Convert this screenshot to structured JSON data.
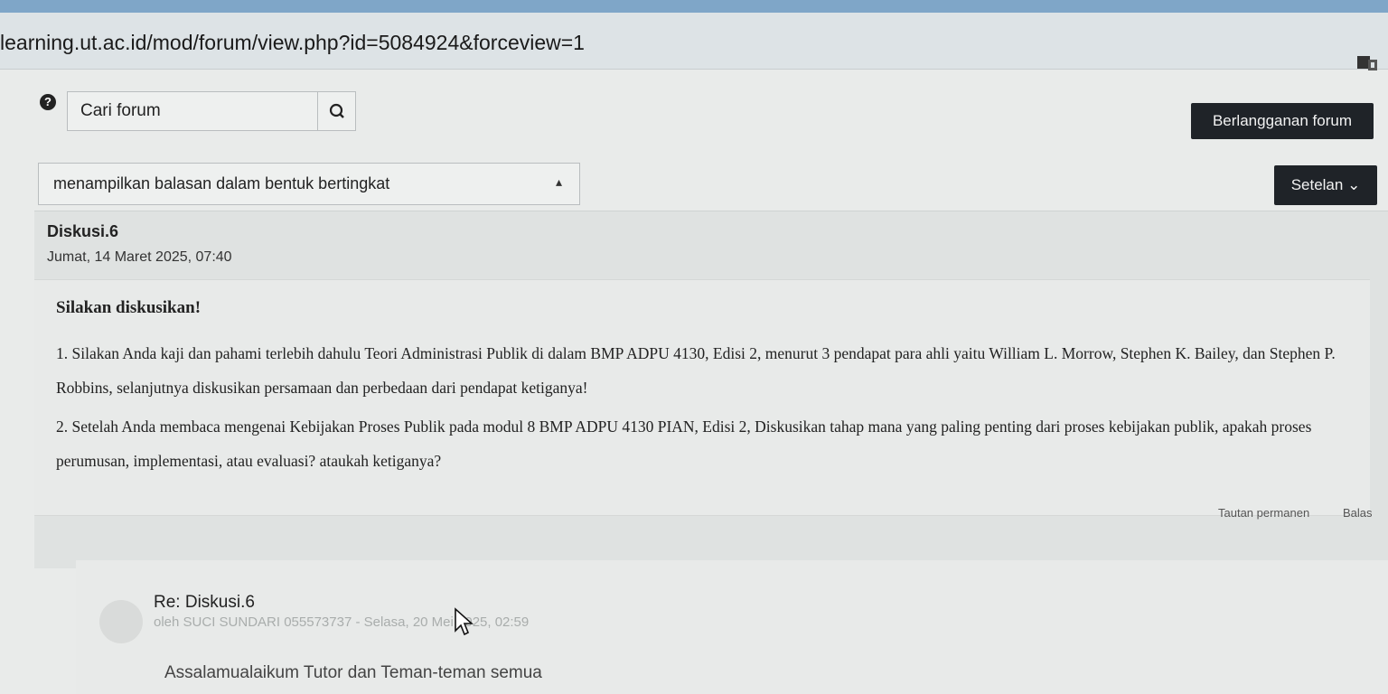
{
  "browser": {
    "url": "learning.ut.ac.id/mod/forum/view.php?id=5084924&forceview=1"
  },
  "toolbar": {
    "search_placeholder": "Cari forum",
    "subscribe_label": "Berlangganan forum",
    "display_mode_value": "menampilkan balasan dalam bentuk bertingkat",
    "settings_label": "Setelan ⌄"
  },
  "icons": {
    "help": "question-circle-icon",
    "search": "search-icon",
    "extension": "extension-icon",
    "cursor": "mouse-cursor-icon"
  },
  "post": {
    "title": "Diskusi.6",
    "date": "Jumat, 14 Maret 2025, 07:40",
    "heading": "Silakan diskusikan!",
    "paragraph1": "1. Silakan Anda kaji dan pahami terlebih dahulu Teori Administrasi Publik di dalam BMP ADPU 4130, Edisi 2, menurut 3 pendapat para ahli yaitu William L. Morrow, Stephen K. Bailey, dan Stephen P. Robbins, selanjutnya diskusikan persamaan dan perbedaan dari pendapat ketiganya!",
    "paragraph2": "2. Setelah Anda membaca mengenai Kebijakan Proses Publik pada modul 8 BMP ADPU 4130 PIAN, Edisi 2,  Diskusikan tahap mana yang paling penting dari proses kebijakan publik, apakah proses perumusan, implementasi, atau evaluasi? ataukah ketiganya?",
    "permalink_label": "Tautan permanen",
    "reply_label": "Balas"
  },
  "reply": {
    "title": "Re: Diskusi.6",
    "meta": "oleh SUCI SUNDARI 055573737 - Selasa, 20 Mei 2025, 02:59",
    "body": "Assalamualaikum Tutor dan Teman-teman semua"
  }
}
